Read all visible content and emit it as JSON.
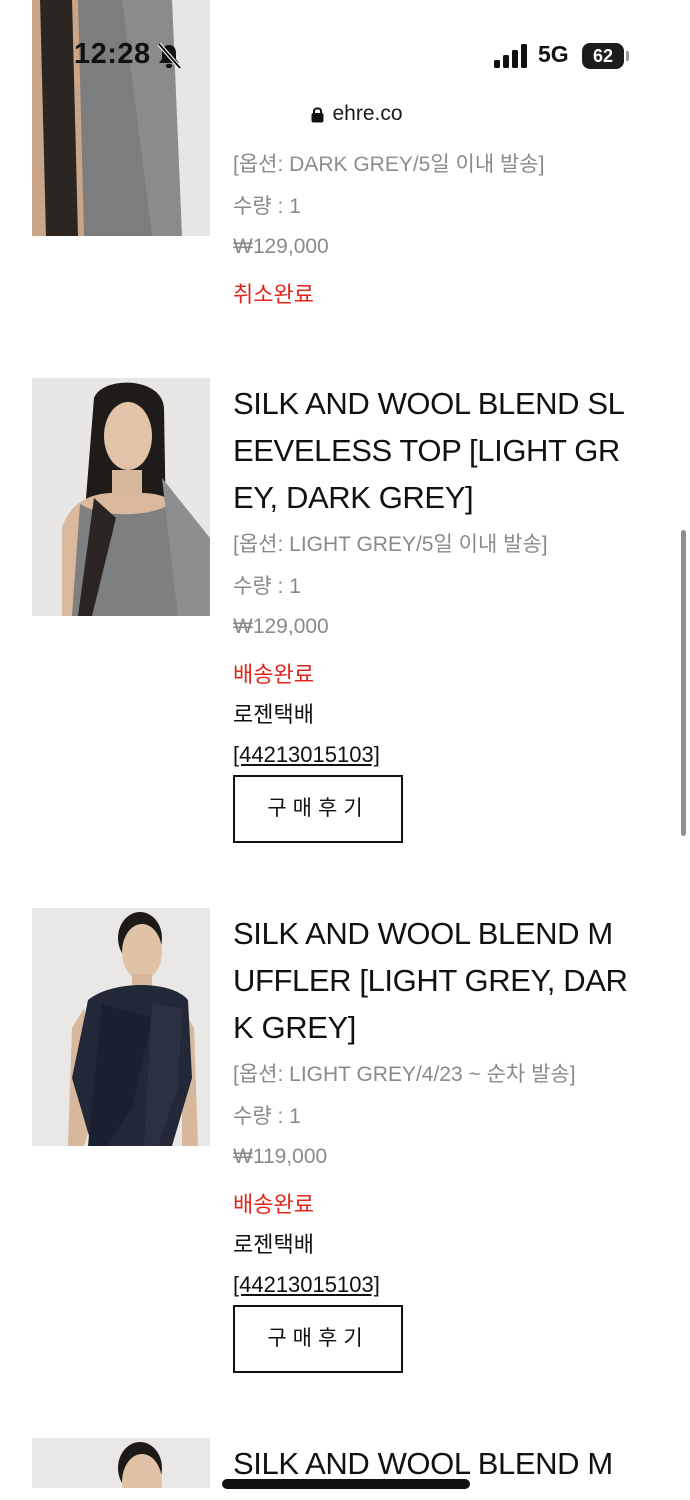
{
  "status_bar": {
    "time": "12:28",
    "network": "5G",
    "battery": "62"
  },
  "browser": {
    "url": "ehre.co"
  },
  "items": [
    {
      "title": "",
      "option": "[옵션: DARK GREY/5일 이내 발송]",
      "quantity": "수량 : 1",
      "price": "₩129,000",
      "status": "취소완료"
    },
    {
      "title": "SILK AND WOOL BLEND SLEEVELESS TOP [LIGHT GREY, DARK GREY]",
      "option": "[옵션: LIGHT GREY/5일 이내 발송]",
      "quantity": "수량 : 1",
      "price": "₩129,000",
      "status": "배송완료",
      "courier": "로젠택배",
      "tracking": "[44213015103]",
      "review_label": "구매후기"
    },
    {
      "title": "SILK AND WOOL BLEND MUFFLER [LIGHT GREY, DARK GREY]",
      "option": "[옵션: LIGHT GREY/4/23 ~ 순차 발송]",
      "quantity": "수량 : 1",
      "price": "₩119,000",
      "status": "배송완료",
      "courier": "로젠택배",
      "tracking": "[44213015103]",
      "review_label": "구매후기"
    },
    {
      "title": "SILK AND WOOL BLEND M"
    }
  ],
  "colors": {
    "status_red": "#e0261c",
    "muted_text": "#8a8a8a",
    "text": "#111111"
  }
}
